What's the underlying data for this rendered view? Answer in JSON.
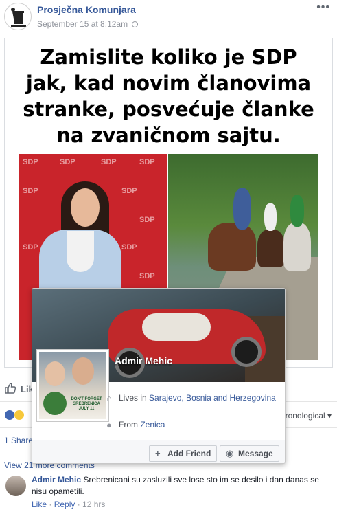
{
  "post": {
    "page_name": "Prosječna Komunjara",
    "timestamp": "September 15 at 8:12am",
    "meme_text_lines": [
      "Zamislite koliko je SDP",
      "jak, kad novim članovima",
      "stranke, posvećuje članke",
      "na zvaničnom sajtu."
    ],
    "sdp_logo_text": "SDP",
    "like_label": "Lik",
    "chronological_label": "ronological",
    "shares_label": "1 Share",
    "view_more_label": "View 21 more comments"
  },
  "hover_card": {
    "name": "Admir Mehic",
    "lives_prefix": "Lives in ",
    "lives_location": "Sarajevo, Bosnia and Herzegovina",
    "from_prefix": "From ",
    "from_location": "Zenica",
    "add_friend_label": "Add Friend",
    "message_label": "Message",
    "profile_caption": "DON'T FORGET SREBRENICA JULY 11"
  },
  "comment": {
    "author": "Admir Mehic",
    "text": "Srebrenicani su zasluzili sve lose sto im se desilo i dan danas se nisu opametili.",
    "like_label": "Like",
    "reply_label": "Reply",
    "time": "12 hrs"
  },
  "icons": {
    "more": "more-options-icon",
    "globe": "globe-icon",
    "like": "thumbs-up-icon",
    "home": "home-icon",
    "pin": "location-pin-icon",
    "add_friend": "add-friend-icon",
    "messenger": "messenger-icon"
  },
  "colors": {
    "link": "#365899",
    "sdp_red": "#c9242b",
    "facebook_blue": "#4267b2"
  }
}
